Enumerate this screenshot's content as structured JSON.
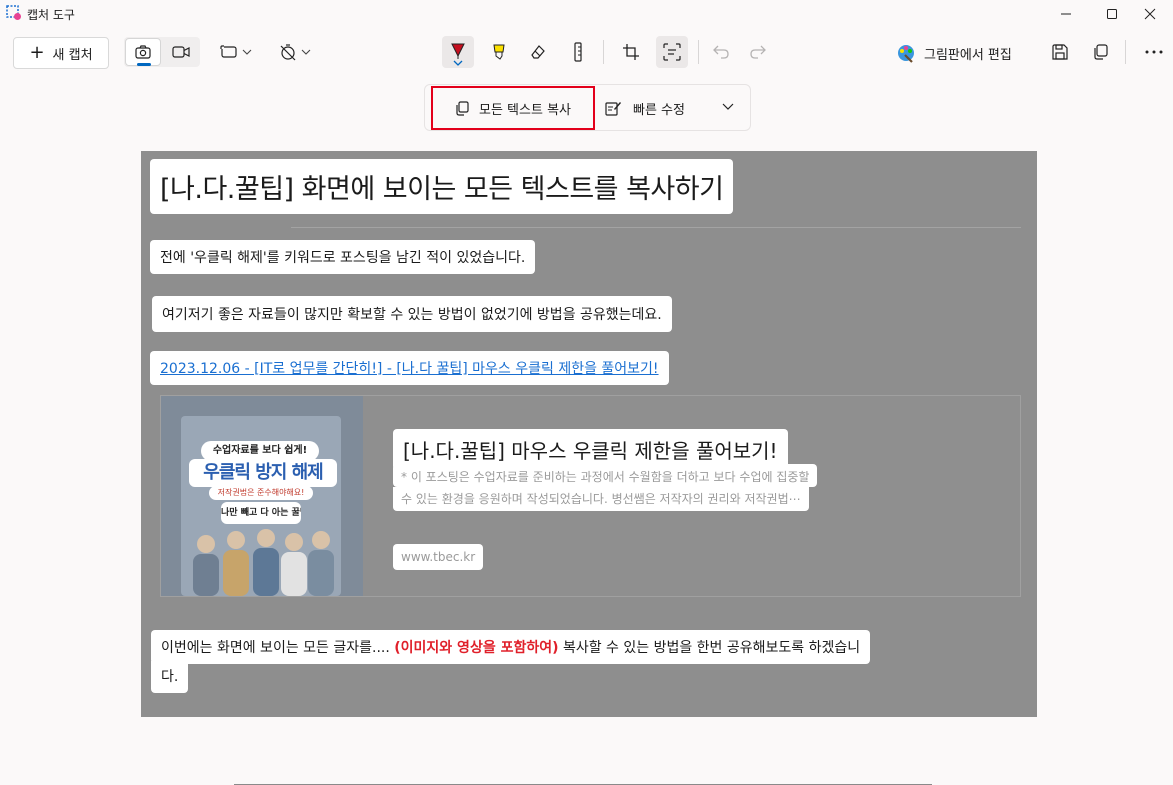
{
  "window": {
    "title": "캡처 도구",
    "controls": [
      "minimize-icon",
      "maximize-icon",
      "close-icon"
    ]
  },
  "toolbar": {
    "new_capture": "새 캡처",
    "modes": [
      {
        "name": "snapshot",
        "icon": "camera-icon",
        "selected": true
      },
      {
        "name": "record",
        "icon": "video-camera-icon",
        "selected": false
      }
    ],
    "shape_dropdown_icon": "rectangle-snip-icon",
    "delay_dropdown_icon": "no-timer-icon",
    "tools": [
      "ballpoint-pen-icon",
      "highlighter-icon",
      "eraser-icon",
      "ruler-icon",
      "crop-icon",
      "text-actions-icon",
      "undo-icon",
      "redo-icon"
    ],
    "active_tool": "ballpoint-pen-icon",
    "pen_color": "#c50f1f",
    "highlighter_color": "#fce100",
    "paint_edit": "그림판에서 편집",
    "save_icon": "save-icon",
    "copy_icon": "copy-icon",
    "more_icon": "more-icon"
  },
  "text_actions": {
    "copy_all": "모든 텍스트 복사",
    "quick_fix": "빠른 수정",
    "highlight_color": "#e3001b"
  },
  "capture": {
    "title": "[나.다.꿀팁] 화면에 보이는 모든 텍스트를 복사하기",
    "para1": "전에 '우클릭 해제'를 키워드로 포스팅을 남긴 적이 있었습니다.",
    "para2": "여기저기 좋은 자료들이 많지만 확보할 수 있는 방법이 없었기에 방법을 공유했는데요.",
    "link": "2023.12.06 - [IT로 업무를 간단히!] - [나.다 꿀팁] 마우스 우클릭 제한을 풀어보기!",
    "card": {
      "title": "[나.다.꿀팁] 마우스 우클릭 제한을 풀어보기!",
      "desc_line1": "* 이 포스팅은 수업자료를 준비하는 과정에서 수월함을 더하고 보다 수업에 집중할",
      "desc_line2": "수 있는 환경을 응원하며 작성되었습니다. 병선쌤은 저작자의 권리와 저작권법⋯",
      "domain": "www.tbec.kr",
      "thumb_line1": "수업자료를 보다 쉽게!",
      "thumb_line2": "우클릭 방지 해제",
      "thumb_line3": "저작권법은 준수해야해요!",
      "thumb_logo": "나만 빼고 다 아는 꿀팁"
    },
    "para3_before": "이번에는 화면에 보이는 모든 글자를.... ",
    "para3_emph": "(이미지와 영상을 포함하여)",
    "para3_after": " 복사할 수 있는 방법을 한번 공유해보도록 하겠습니",
    "para3_tail": "다.",
    "link_color": "#1a6fd1",
    "emph_color": "#e0202a"
  }
}
